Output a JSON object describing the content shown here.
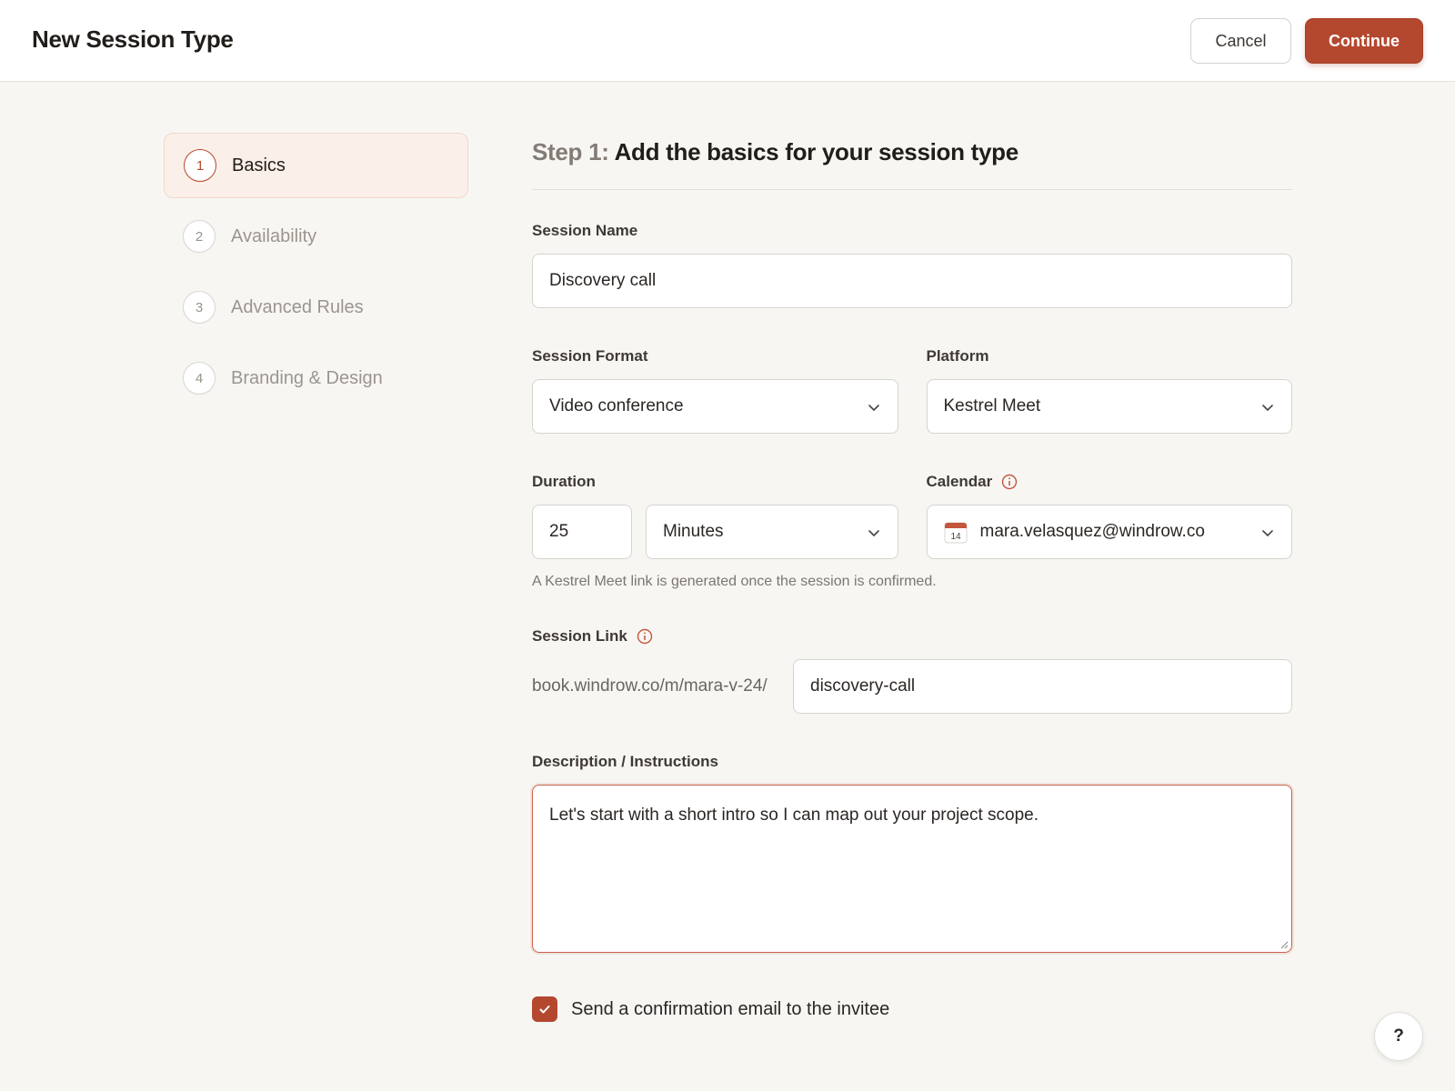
{
  "header": {
    "title": "New Session Type",
    "cancel_label": "Cancel",
    "continue_label": "Continue"
  },
  "steps": [
    {
      "number": "1",
      "label": "Basics",
      "active": true
    },
    {
      "number": "2",
      "label": "Availability",
      "active": false
    },
    {
      "number": "3",
      "label": "Advanced Rules",
      "active": false
    },
    {
      "number": "4",
      "label": "Branding & Design",
      "active": false
    }
  ],
  "form": {
    "heading_prefix": "Step 1:",
    "heading_text": "Add the basics for your session type",
    "session_name": {
      "label": "Session Name",
      "value": "Discovery call"
    },
    "session_format": {
      "label": "Session Format",
      "value": "Video conference"
    },
    "platform": {
      "label": "Platform",
      "value": "Kestrel Meet"
    },
    "duration": {
      "label": "Duration",
      "amount": "25",
      "unit": "Minutes"
    },
    "calendar": {
      "label": "Calendar",
      "value": "mara.velasquez@windrow.co",
      "icon_day": "14"
    },
    "helper_text": "A Kestrel Meet link is generated once the session is confirmed.",
    "session_link": {
      "label": "Session Link",
      "prefix": "book.windrow.co/m/mara-v-24/",
      "slug": "discovery-call"
    },
    "description": {
      "label": "Description / Instructions",
      "value": "Let's start with a short intro so I can map out your project scope."
    },
    "confirmation": {
      "label": "Send a confirmation email to the invitee",
      "checked": true
    }
  },
  "help_label": "?",
  "colors": {
    "accent": "#b4482f",
    "background": "#f7f6f3"
  },
  "icons": [
    "chevron-down-icon",
    "info-icon",
    "calendar-icon",
    "checkmark-icon",
    "resize-handle-icon"
  ]
}
